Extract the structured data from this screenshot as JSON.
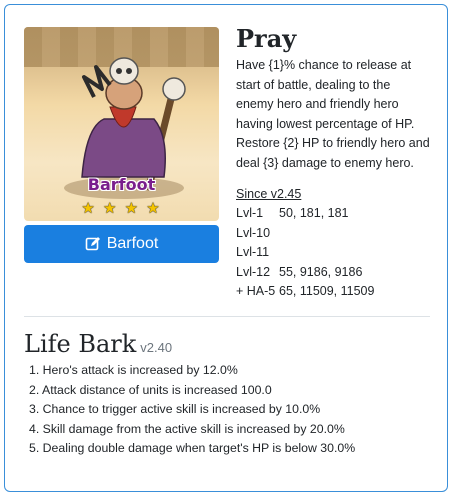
{
  "hero": {
    "name": "Barfoot",
    "stars": [
      "★",
      "★",
      "★",
      "★"
    ],
    "button_label": "Barfoot",
    "button_icon": "edit-icon"
  },
  "skill": {
    "title": "Pray",
    "description": "Have {1}% chance to release at start of battle, dealing to the enemy hero and friendly hero having lowest percentage of HP. Restore {2} HP to friendly hero and deal {3} damage to enemy hero.",
    "since": "Since v2.45",
    "levels": [
      {
        "name": "Lvl-1",
        "value": "50, 181, 181"
      },
      {
        "name": "Lvl-10",
        "value": ""
      },
      {
        "name": "Lvl-11",
        "value": ""
      },
      {
        "name": "Lvl-12",
        "value": "55, 9186, 9186"
      },
      {
        "name": "+ HA-5",
        "value": "65, 11509, 11509"
      }
    ]
  },
  "life_bark": {
    "title": "Life Bark",
    "version": "v2.40",
    "items": [
      "1. Hero's attack is increased by 12.0%",
      "2. Attack distance of units is increased 100.0",
      "3. Chance to trigger active skill is increased by 10.0%",
      "4. Skill damage from the active skill is increased by 20.0%",
      "5. Dealing double damage when target's HP is below 30.0%"
    ]
  },
  "colors": {
    "accent": "#1a7fe0",
    "card_border": "#3a8fd9",
    "hero_name": "#7a1e8c",
    "star": "#f5c400"
  }
}
